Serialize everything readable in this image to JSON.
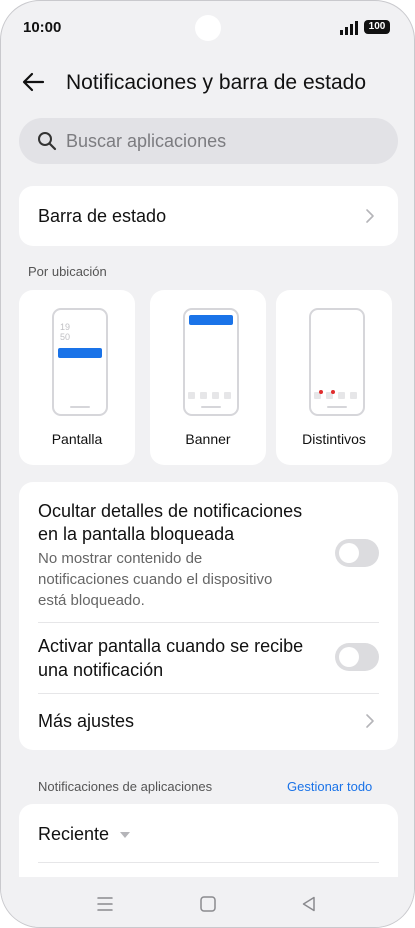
{
  "status_bar": {
    "time": "10:00",
    "battery": "100"
  },
  "header": {
    "title": "Notificaciones y barra de estado"
  },
  "search": {
    "placeholder": "Buscar aplicaciones"
  },
  "status_bar_row": {
    "label": "Barra de estado"
  },
  "by_location": {
    "section_label": "Por ubicación",
    "options": [
      {
        "label": "Pantalla",
        "clock_top": "19",
        "clock_bottom": "50"
      },
      {
        "label": "Banner"
      },
      {
        "label": "Distintivos"
      }
    ]
  },
  "settings": {
    "hide_details": {
      "title_line1": "Ocultar detalles de notificaciones",
      "title_line2": "en la pantalla bloqueada",
      "desc_line1": "No mostrar contenido de",
      "desc_line2": "notificaciones cuando el dispositivo",
      "desc_line3": "está bloqueado.",
      "enabled": false
    },
    "wake_screen": {
      "title_line1": "Activar pantalla cuando se recibe",
      "title_line2": "una notificación",
      "enabled": false
    },
    "more_settings": {
      "label": "Más ajustes"
    }
  },
  "app_notifications": {
    "section_label": "Notificaciones de aplicaciones",
    "manage_all": "Gestionar todo",
    "sort_label": "Reciente"
  },
  "colors": {
    "accent": "#1a73e8",
    "badge": "#e02d2d",
    "page_bg": "#f1f1f3"
  },
  "icons": [
    "back-arrow-icon",
    "search-icon",
    "chevron-right-icon",
    "caret-down-icon",
    "menu-icon",
    "home-icon",
    "back-triangle-icon"
  ]
}
